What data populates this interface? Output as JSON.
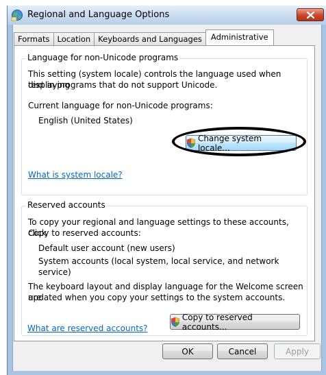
{
  "window": {
    "title": "Regional and Language Options"
  },
  "tabs": [
    {
      "label": "Formats"
    },
    {
      "label": "Location"
    },
    {
      "label": "Keyboards and Languages"
    },
    {
      "label": "Administrative",
      "active": true
    }
  ],
  "unicode_group": {
    "title": "Language for non-Unicode programs",
    "description_line1": "This setting (system locale) controls the language used when displaying",
    "description_line2": "text in programs that do not support Unicode.",
    "current_label": "Current language for non-Unicode programs:",
    "current_value": "English (United States)",
    "change_button": "Change system locale...",
    "help_link": "What is system locale?"
  },
  "reserved_group": {
    "title": "Reserved accounts",
    "line1": "To copy your regional and language settings to these accounts, click",
    "line2": "Copy to reserved accounts:",
    "account1": "Default user account (new users)",
    "account2": "System accounts (local system, local service, and network service)",
    "note_line1": "The keyboard layout and display language for the Welcome screen are",
    "note_line2": "updated when you copy your settings to the system accounts.",
    "copy_button": "Copy to reserved accounts...",
    "help_link": "What are reserved accounts?"
  },
  "footer": {
    "ok": "OK",
    "cancel": "Cancel",
    "apply": "Apply"
  },
  "icons": {
    "title": "globe-icon",
    "shield": "uac-shield-icon",
    "close": "close-icon"
  },
  "colors": {
    "link": "#0066cc",
    "titlebar": "#c9dbef",
    "close": "#c8452a",
    "highlight_button": "#bee6fd"
  }
}
